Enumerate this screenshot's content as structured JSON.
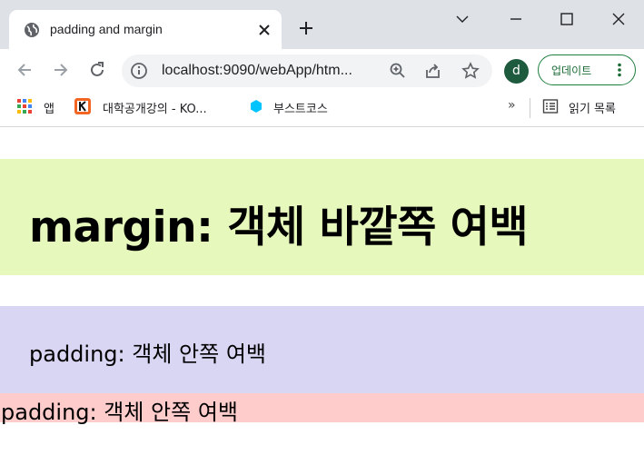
{
  "tab": {
    "title": "padding and margin",
    "favicon": "globe-icon"
  },
  "toolbar": {
    "url": "localhost:9090/webApp/htm...",
    "profile_initial": "d",
    "update_label": "업데이트"
  },
  "bookmarks": {
    "items": [
      {
        "label": "앱",
        "icon": "apps-grid-icon"
      },
      {
        "label": "대학공개강의 - KO...",
        "icon": "kocw-icon"
      },
      {
        "label": "부스트코스",
        "icon": "boostcourse-icon"
      }
    ],
    "overflow": "»",
    "reading_list": "읽기 목록"
  },
  "page": {
    "margin_heading": "margin: 객체 바깥쪽 여백",
    "padding_text_1": "padding: 객체 안쪽 여백",
    "padding_text_2": "padding: 객체 안쪽 여백"
  },
  "colors": {
    "margin_bg": "#e6f8bc",
    "padding_bg_1": "#d9d6f3",
    "padding_bg_2": "#ffcccc",
    "update_accent": "#1e7e3e",
    "profile_bg": "#1e5b3e"
  }
}
